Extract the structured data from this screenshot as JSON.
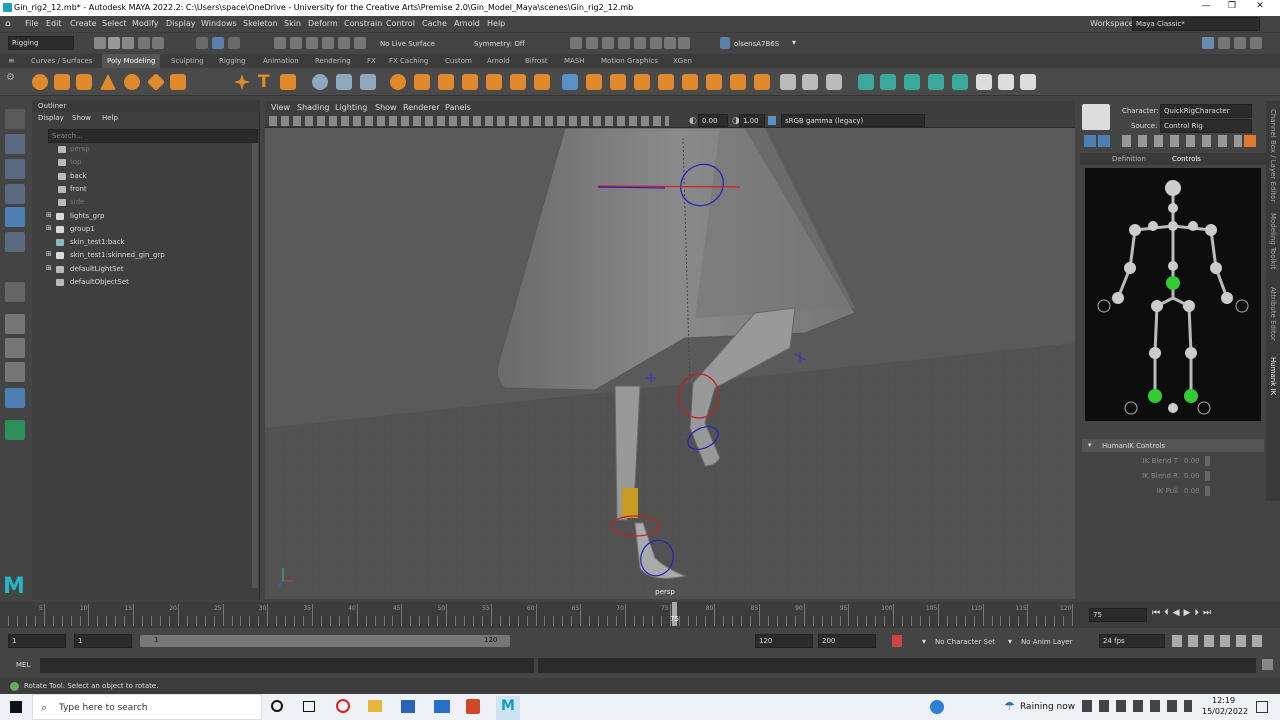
{
  "title_bar": {
    "title": "Gin_rig2_12.mb* - Autodesk MAYA 2022.2: C:\\Users\\space\\OneDrive - University for the Creative Arts\\Premise 2.0\\Gin_Model_Maya\\scenes\\Gin_rig2_12.mb"
  },
  "menu": [
    "File",
    "Edit",
    "Create",
    "Select",
    "Modify",
    "Display",
    "Windows",
    "Skeleton",
    "Skin",
    "Deform",
    "Constrain",
    "Control",
    "Cache",
    "Arnold",
    "Help"
  ],
  "workspace": {
    "label": "Workspace:",
    "value": "Maya Classic*"
  },
  "status_line": {
    "menu_set": "Rigging",
    "live_surface": "No Live Surface",
    "symmetry": "Symmetry: Off",
    "user": "olsensA7B6S"
  },
  "shelf_tabs": [
    "Curves / Surfaces",
    "Poly Modeling",
    "Sculpting",
    "Rigging",
    "Animation",
    "Rendering",
    "FX",
    "FX Caching",
    "Custom",
    "Arnold",
    "Bifrost",
    "MASH",
    "Motion Graphics",
    "XGen"
  ],
  "active_shelf": "Poly Modeling",
  "outliner": {
    "title": "Outliner",
    "menu": [
      "Display",
      "Show",
      "Help"
    ],
    "search_placeholder": "Search...",
    "items": [
      {
        "label": "persp",
        "dim": true
      },
      {
        "label": "top",
        "dim": true
      },
      {
        "label": "back",
        "dim": false
      },
      {
        "label": "front",
        "dim": false
      },
      {
        "label": "side",
        "dim": true
      },
      {
        "label": "lights_grp",
        "dim": false
      },
      {
        "label": "group1",
        "dim": false
      },
      {
        "label": "skin_test1:back",
        "dim": false
      },
      {
        "label": "skin_test1:skinned_gin_grp",
        "dim": false
      },
      {
        "label": "defaultLightSet",
        "dim": false
      },
      {
        "label": "defaultObjectSet",
        "dim": false
      }
    ]
  },
  "viewport": {
    "menu": [
      "View",
      "Shading",
      "Lighting",
      "Show",
      "Renderer",
      "Panels"
    ],
    "exposure": "0.00",
    "gamma": "1.00",
    "color_space": "sRGB gamma (legacy)",
    "camera_label": "persp"
  },
  "humanik": {
    "character_label": "Character:",
    "character": "QuickRigCharacter",
    "source_label": "Source:",
    "source": "Control Rig",
    "tabs": [
      "Definition",
      "Controls"
    ],
    "active_tab": "Controls",
    "controls_title": "HumanIK Controls",
    "params": [
      {
        "label": "IK Blend T",
        "value": "0.00"
      },
      {
        "label": "IK Blend R",
        "value": "0.00"
      },
      {
        "label": "IK Pull",
        "value": "0.00"
      }
    ]
  },
  "side_tabs": [
    "Channel Box / Layer Editor",
    "Modeling Toolkit",
    "Attribute Editor",
    "Humank IK"
  ],
  "timeline": {
    "ticks": [
      "5",
      "10",
      "15",
      "20",
      "25",
      "30",
      "35",
      "40",
      "45",
      "50",
      "55",
      "60",
      "65",
      "70",
      "75",
      "80",
      "85",
      "90",
      "95",
      "100",
      "105",
      "110",
      "115",
      "120"
    ],
    "current_frame": "75",
    "current_field": "75"
  },
  "range": {
    "start": "1",
    "start2": "1",
    "slider_start": "1",
    "slider_end": "120",
    "end": "120",
    "end2": "200",
    "character_set": "No Character Set",
    "anim_layer": "No Anim Layer",
    "fps": "24 fps"
  },
  "cmd": {
    "label": "MEL"
  },
  "help_line": "Rotate Tool: Select an object to rotate.",
  "taskbar": {
    "search_placeholder": "Type here to search",
    "weather": "Raining now",
    "time": "12:19",
    "date": "15/02/2022"
  }
}
